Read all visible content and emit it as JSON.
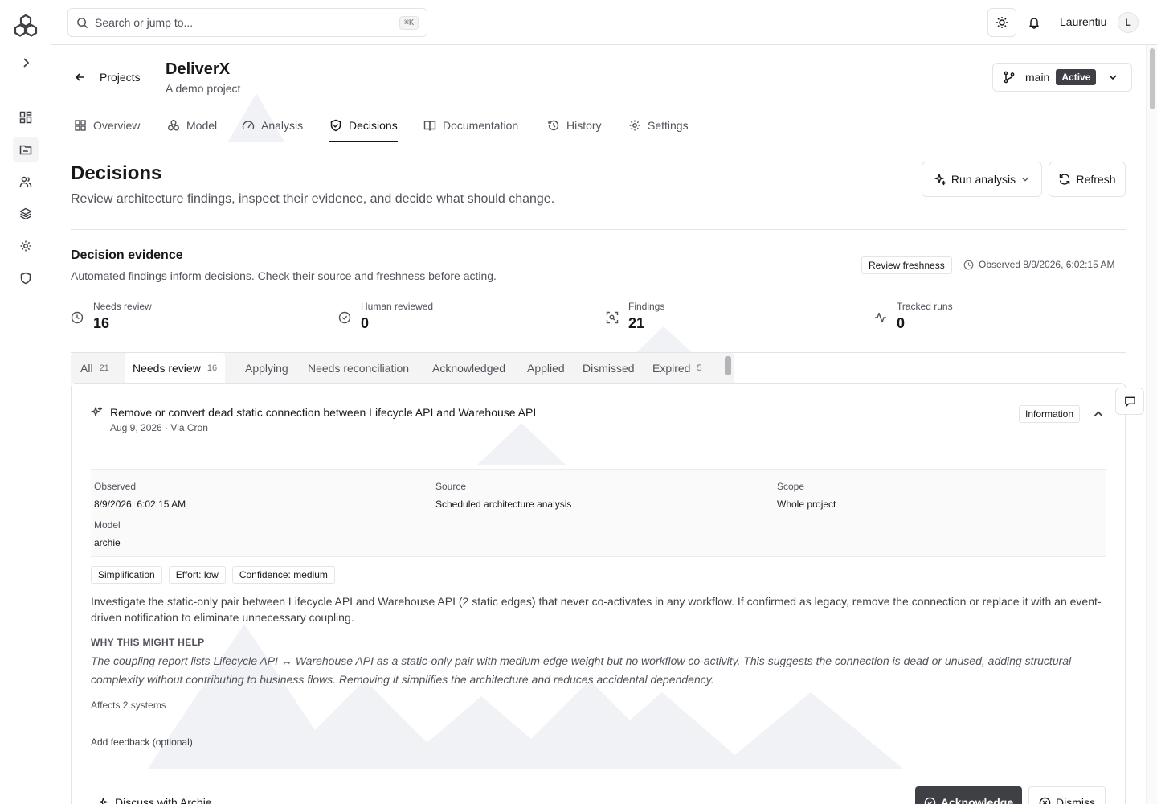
{
  "search": {
    "placeholder": "Search or jump to...",
    "shortcut": "⌘K"
  },
  "user": {
    "name": "Laurentiu",
    "initial": "L"
  },
  "sidebar": {
    "icons": [
      "expand-icon",
      "dashboard-icon",
      "projects-icon",
      "users-icon",
      "layers-icon",
      "settings-icon",
      "shield-icon"
    ]
  },
  "project": {
    "back_label": "Projects",
    "title": "DeliverX",
    "subtitle": "A demo project",
    "branch": "main",
    "branch_status": "Active"
  },
  "tabs": [
    {
      "label": "Overview",
      "icon": "grid-icon"
    },
    {
      "label": "Model",
      "icon": "model-icon"
    },
    {
      "label": "Analysis",
      "icon": "gauge-icon"
    },
    {
      "label": "Decisions",
      "icon": "shield-check-icon",
      "active": true
    },
    {
      "label": "Documentation",
      "icon": "book-icon"
    },
    {
      "label": "History",
      "icon": "history-icon"
    },
    {
      "label": "Settings",
      "icon": "gear-icon"
    }
  ],
  "page": {
    "title": "Decisions",
    "description": "Review architecture findings, inspect their evidence, and decide what should change.",
    "run_analysis": "Run analysis",
    "refresh": "Refresh"
  },
  "evidence": {
    "title": "Decision evidence",
    "description": "Automated findings inform decisions. Check their source and freshness before acting.",
    "freshness_button": "Review freshness",
    "observed": "Observed 8/9/2026, 6:02:15 AM",
    "stats": [
      {
        "label": "Needs review",
        "value": "16"
      },
      {
        "label": "Human reviewed",
        "value": "0"
      },
      {
        "label": "Findings",
        "value": "21"
      },
      {
        "label": "Tracked runs",
        "value": "0"
      }
    ]
  },
  "filter_tabs": [
    {
      "label": "All",
      "count": "21"
    },
    {
      "label": "Needs review",
      "count": "16",
      "active": true
    },
    {
      "label": "Applying",
      "count": ""
    },
    {
      "label": "Needs reconciliation",
      "count": ""
    },
    {
      "label": "Acknowledged",
      "count": ""
    },
    {
      "label": "Applied",
      "count": ""
    },
    {
      "label": "Dismissed",
      "count": ""
    },
    {
      "label": "Expired",
      "count": "5"
    }
  ],
  "finding": {
    "title": "Remove or convert dead static connection between Lifecycle API and Warehouse API",
    "date": "Aug 9, 2026",
    "via": "· Via Cron",
    "severity": "Information",
    "meta": {
      "observed_label": "Observed",
      "observed_value": "8/9/2026, 6:02:15 AM",
      "source_label": "Source",
      "source_value": "Scheduled architecture analysis",
      "scope_label": "Scope",
      "scope_value": "Whole project",
      "model_label": "Model",
      "model_value": "archie"
    },
    "chips": [
      "Simplification",
      "Effort: low",
      "Confidence: medium"
    ],
    "summary": "Investigate the static-only pair between Lifecycle API and Warehouse API (2 static edges) that never co-activates in any workflow. If confirmed as legacy, remove the connection or replace it with an event-driven notification to eliminate unnecessary coupling.",
    "why_heading": "WHY THIS MIGHT HELP",
    "why_text": "The coupling report lists Lifecycle API ↔ Warehouse API as a static-only pair with medium edge weight but no workflow co-activity. This suggests the connection is dead or unused, adding structural complexity without contributing to business flows. Removing it simplifies the architecture and reduces accidental dependency.",
    "affects": "Affects 2 systems",
    "feedback_label": "Add feedback (optional)",
    "discuss": "Discuss with Archie",
    "acknowledge": "Acknowledge",
    "dismiss": "Dismiss"
  }
}
